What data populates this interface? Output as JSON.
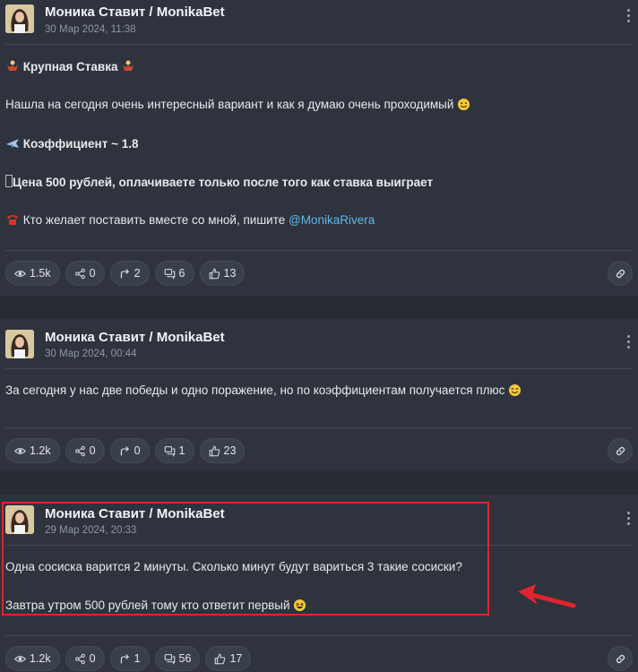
{
  "posts": [
    {
      "author": "Моника Ставит / MonikaBet",
      "date": "30 Мар 2024, 11:38",
      "lines": [
        "Крупная Ставка",
        "Нашла на сегодня очень интересный вариант и как я думаю очень проходимый",
        "Коэффициент ~ 1.8",
        "Цена 500 рублей, оплачиваете только после того как ставка выиграет",
        "Кто желает поставить вместе со мной, пишите",
        "@MonikaRivera"
      ],
      "stats": {
        "views": "1.5k",
        "shares": "0",
        "forwards": "2",
        "comments": "6",
        "likes": "13"
      }
    },
    {
      "author": "Моника Ставит / MonikaBet",
      "date": "30 Мар 2024, 00:44",
      "lines": [
        "За сегодня у нас две победы и одно поражение, но по коэффициентам получается плюс"
      ],
      "stats": {
        "views": "1.2k",
        "shares": "0",
        "forwards": "0",
        "comments": "1",
        "likes": "23"
      }
    },
    {
      "author": "Моника Ставит / MonikaBet",
      "date": "29 Мар 2024, 20:33",
      "lines": [
        "Одна сосиска варится 2 минуты. Сколько минут будут вариться 3 такие сосиски?",
        "Завтра утром 500 рублей тому кто ответит первый"
      ],
      "stats": {
        "views": "1.2k",
        "shares": "0",
        "forwards": "1",
        "comments": "56",
        "likes": "17"
      }
    }
  ],
  "colors": {
    "background": "#272b33",
    "card": "#2e333d",
    "mention": "#5fb8e8",
    "highlight": "#e0242e"
  },
  "icons": [
    "eye-icon",
    "share-icon",
    "forward-icon",
    "comments-icon",
    "thumbs-up-icon",
    "link-icon",
    "more-vertical-icon"
  ]
}
